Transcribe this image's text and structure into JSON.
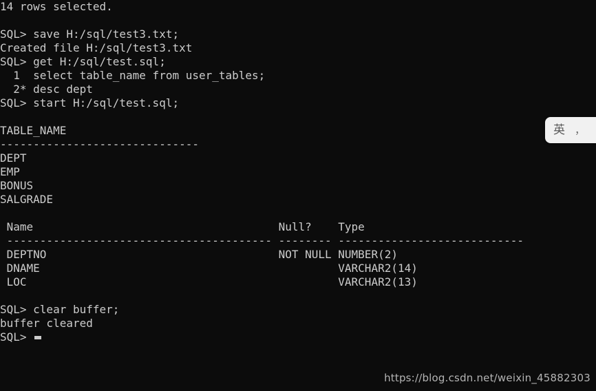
{
  "terminal": {
    "background_color": "#0c0c0c",
    "foreground_color": "#cccccc",
    "prompt": "SQL>",
    "lines": [
      "14 rows selected.",
      "",
      "SQL> save H:/sql/test3.txt;",
      "Created file H:/sql/test3.txt",
      "SQL> get H:/sql/test.sql;",
      "  1  select table_name from user_tables;",
      "  2* desc dept",
      "SQL> start H:/sql/test.sql;",
      "",
      "TABLE_NAME",
      "------------------------------",
      "DEPT",
      "EMP",
      "BONUS",
      "SALGRADE",
      "",
      " Name                                     Null?    Type",
      " ---------------------------------------- -------- ----------------------------",
      " DEPTNO                                   NOT NULL NUMBER(2)",
      " DNAME                                             VARCHAR2(14)",
      " LOC                                               VARCHAR2(13)",
      "",
      "SQL> clear buffer;",
      "buffer cleared",
      "SQL>"
    ]
  },
  "ime_widget": {
    "mode_label": "英",
    "punctuation_label": "，",
    "extra_label": "（"
  },
  "watermark": {
    "text": "https://blog.csdn.net/weixin_45882303"
  }
}
